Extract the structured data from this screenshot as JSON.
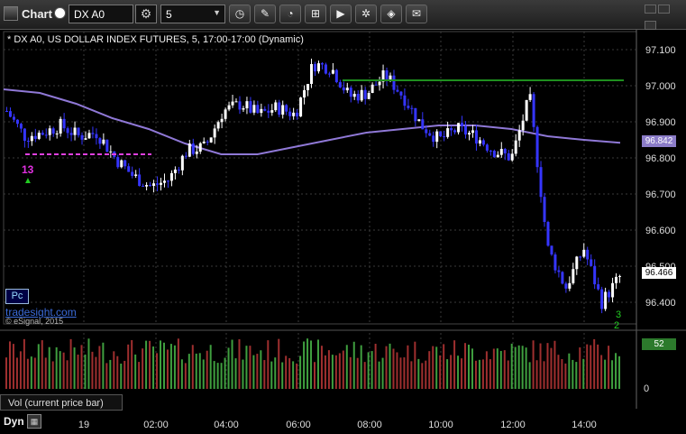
{
  "window": {
    "app_title": "Chart"
  },
  "toolbar": {
    "symbol_value": "DX A0",
    "interval_value": "5",
    "tools": [
      "clock-icon",
      "pencil-icon",
      "speedometer-icon",
      "pattern-icon",
      "play-icon",
      "compass-icon",
      "diamond-icon",
      "chat-icon"
    ]
  },
  "chart": {
    "title": "* DX A0, US DOLLAR INDEX FUTURES, 5, 17:00-17:00 (Dynamic)",
    "pc_badge": "Pc",
    "watermark_link": "tradesight.com",
    "copyright": "© eSignal, 2015",
    "count_setup": "13",
    "count_a": "3",
    "count_b": "2",
    "avg_tag": "96.842",
    "last_tag": "96.466",
    "volume_tag": "52",
    "volume_zero": "0",
    "volume_study_label": "Vol (current price bar)",
    "dyn_label": "Dyn"
  },
  "chart_data": {
    "type": "candlestick",
    "y_axis": {
      "labels": [
        "97.100",
        "97.000",
        "96.900",
        "96.800",
        "96.700",
        "96.600",
        "96.500",
        "96.400"
      ],
      "range": [
        96.34,
        97.15
      ]
    },
    "x_axis": {
      "labels": [
        "19",
        "02:00",
        "04:00",
        "06:00",
        "08:00",
        "10:00",
        "12:00",
        "14:00"
      ]
    },
    "resistance_level": 97.015,
    "support_dashed_level": 96.81,
    "moving_average": [
      96.99,
      96.98,
      96.95,
      96.91,
      96.88,
      96.84,
      96.81,
      96.81,
      96.83,
      96.85,
      96.87,
      96.88,
      96.89,
      96.89,
      96.88,
      96.86,
      96.85,
      96.842
    ],
    "price_path": [
      96.93,
      96.86,
      96.87,
      96.89,
      96.86,
      96.87,
      96.8,
      96.75,
      96.72,
      96.74,
      96.82,
      96.83,
      96.93,
      96.95,
      96.92,
      96.94,
      96.92,
      97.06,
      97.05,
      96.97,
      96.98,
      97.03,
      96.97,
      96.89,
      96.85,
      96.88,
      96.86,
      96.82,
      96.8,
      96.97,
      96.55,
      96.44,
      96.55,
      96.4,
      96.47
    ],
    "volume_max": 80,
    "colors": {
      "up": "#ffffff",
      "down": "#3535ff",
      "ma": "#8f78d6",
      "resistance": "#1f8f1f",
      "support": "#e040e0",
      "vol_up": "#3f9f3f",
      "vol_down": "#9f2f2f"
    }
  }
}
